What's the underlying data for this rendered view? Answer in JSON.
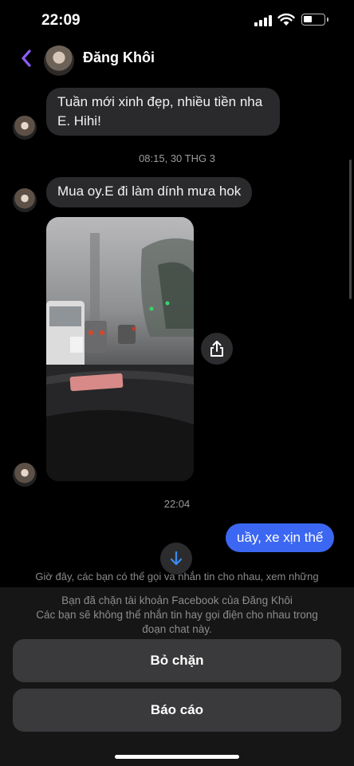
{
  "status_bar": {
    "time": "22:09"
  },
  "header": {
    "contact_name": "Đăng Khôi"
  },
  "messages": [
    {
      "text": "Tuần mới xinh đẹp, nhiều tiền nha E. Hihi!"
    },
    {
      "text": "Mua oy.E đi làm dính mưa hok"
    },
    {
      "text": "uầy, xe xịn thế"
    }
  ],
  "timestamps": [
    "08:15, 30 THG 3",
    "22:04"
  ],
  "info_text": "Giờ đây, các bạn có thể gọi và nhắn tin cho nhau, xem những",
  "blocked_notice": {
    "line1": "Bạn đã chặn tài khoản Facebook của Đăng Khôi",
    "line2": "Các bạn sẽ không thể nhắn tin hay gọi điện cho nhau trong đoạn chat này."
  },
  "buttons": {
    "unblock": "Bỏ chặn",
    "report": "Báo cáo"
  },
  "colors": {
    "accent": "#8b5cf6",
    "outgoing_bubble": "#3c67f2",
    "incoming_bubble": "#2a2a2c",
    "background": "#000000"
  },
  "icons": {
    "back": "chevron-left-icon",
    "share": "share-icon",
    "scroll_down": "arrow-down-icon"
  }
}
